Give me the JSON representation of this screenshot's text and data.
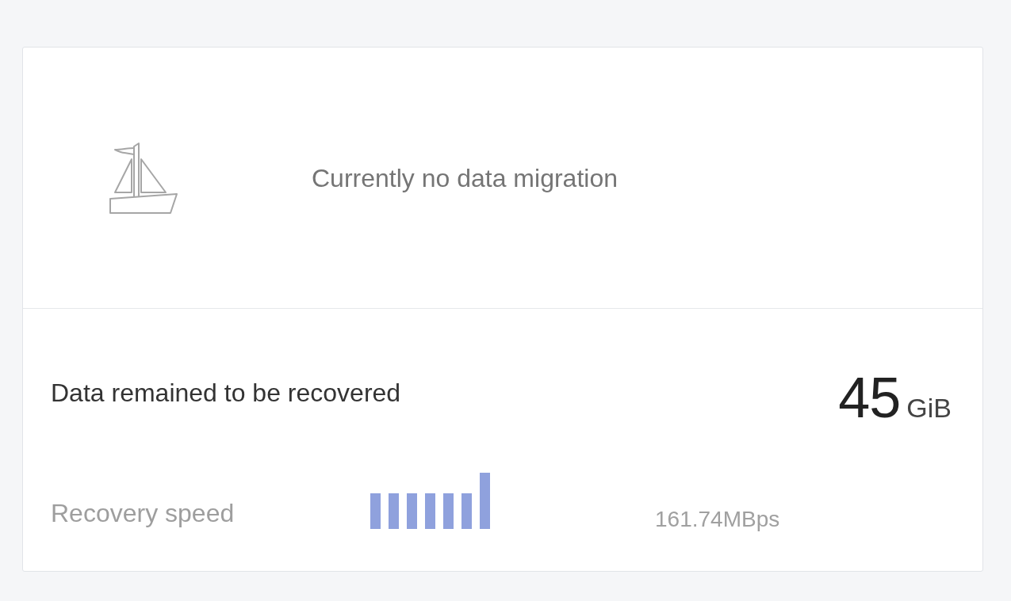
{
  "migration": {
    "message": "Currently no data migration"
  },
  "recovery": {
    "label": "Data remained to be recovered",
    "amount": "45",
    "unit": "GiB",
    "speed_label": "Recovery speed",
    "speed": "161.74MBps"
  }
}
